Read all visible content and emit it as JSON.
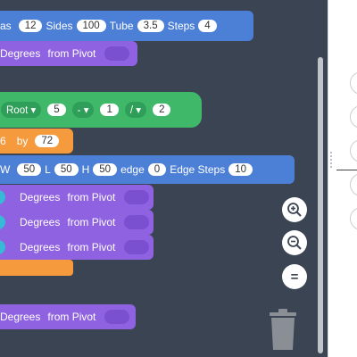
{
  "block_row1": {
    "prefix": "as",
    "sides_value": "12",
    "sides_label": "Sides",
    "tube_value": "100",
    "tube_label": "Tube",
    "steps_value": "3.5",
    "steps_label": "Steps",
    "steps_count": "4"
  },
  "block_row2": {
    "label": "Degrees",
    "pivot_label": "from Pivot"
  },
  "root_block": {
    "op_label": "Root",
    "value1": "5",
    "op2": "-",
    "value2": "1",
    "op3": "/",
    "value3": "2"
  },
  "by_block": {
    "value1": "6",
    "label": "by",
    "value2": "72"
  },
  "edge_block": {
    "prefix": "W",
    "w_value": "50",
    "l_label": "L",
    "l_value": "50",
    "h_label": "H",
    "h_value": "50",
    "edge_label": "edge",
    "edge_value": "0",
    "edge_steps_label": "Edge Steps",
    "edge_steps_value": "10"
  },
  "rotate_blocks": [
    {
      "label": "Degrees",
      "pivot_label": "from Pivot"
    },
    {
      "label": "Degrees",
      "pivot_label": "from Pivot"
    },
    {
      "label": "Degrees",
      "pivot_label": "from Pivot"
    }
  ],
  "bottom_block": {
    "label": "Degrees",
    "pivot_label": "from Pivot"
  },
  "zoom": {
    "in": "+",
    "out": "−",
    "reset": "="
  },
  "colors": {
    "blue": "#4c7fd6",
    "purple": "#8e62e0",
    "orange": "#f59a3d",
    "green": "#3fb86a",
    "workspace": "#3b4452"
  }
}
